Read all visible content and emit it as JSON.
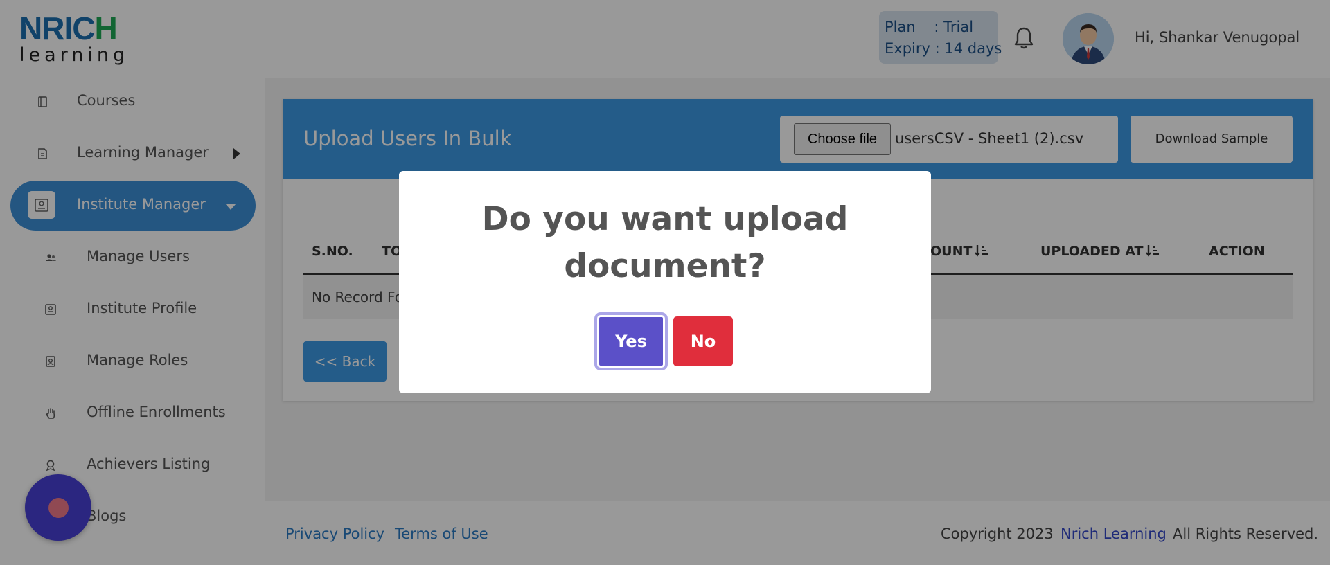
{
  "brand": {
    "logo_text_top": "NRICH",
    "logo_text_bottom": "learning"
  },
  "header": {
    "plan_line": "Plan    : Trial",
    "expiry_line": "Expiry : 14 days",
    "greeting": "Hi, Shankar Venugopal"
  },
  "sidebar": {
    "items": [
      {
        "label": "Courses",
        "icon": "book-icon"
      },
      {
        "label": "Learning Manager",
        "icon": "document-icon"
      },
      {
        "label": "Institute Manager",
        "icon": "id-card-icon",
        "active": true
      },
      {
        "label": "Manage Users",
        "icon": "users-icon"
      },
      {
        "label": "Institute Profile",
        "icon": "profile-card-icon"
      },
      {
        "label": "Manage Roles",
        "icon": "role-badge-icon"
      },
      {
        "label": "Offline Enrollments",
        "icon": "hand-icon"
      },
      {
        "label": "Achievers Listing",
        "icon": "award-icon"
      },
      {
        "label": "Blogs",
        "icon": "blog-icon"
      }
    ]
  },
  "main": {
    "title": "Upload Users In Bulk",
    "choose_file_label": "Choose file",
    "file_name": "usersCSV - Sheet1 (2).csv",
    "download_sample_label": "Download Sample",
    "table": {
      "columns": [
        "S.NO.",
        "TO",
        "OUNT",
        "UPLOADED AT",
        "ACTION"
      ],
      "empty_text": "No Record Fo"
    },
    "back_label": "<< Back"
  },
  "footer": {
    "privacy": "Privacy Policy",
    "terms": "Terms of Use",
    "copyright_prefix": "Copyright 2023",
    "brand_link": "Nrich Learning",
    "rights": "All Rights Reserved."
  },
  "modal": {
    "title": "Do you want upload document?",
    "yes_label": "Yes",
    "no_label": "No"
  },
  "colors": {
    "accent": "#3d99e4",
    "active_nav": "#3d8fd8",
    "yes_button": "#5b50c8",
    "no_button": "#e02e3c",
    "fab": "#4840d6"
  }
}
